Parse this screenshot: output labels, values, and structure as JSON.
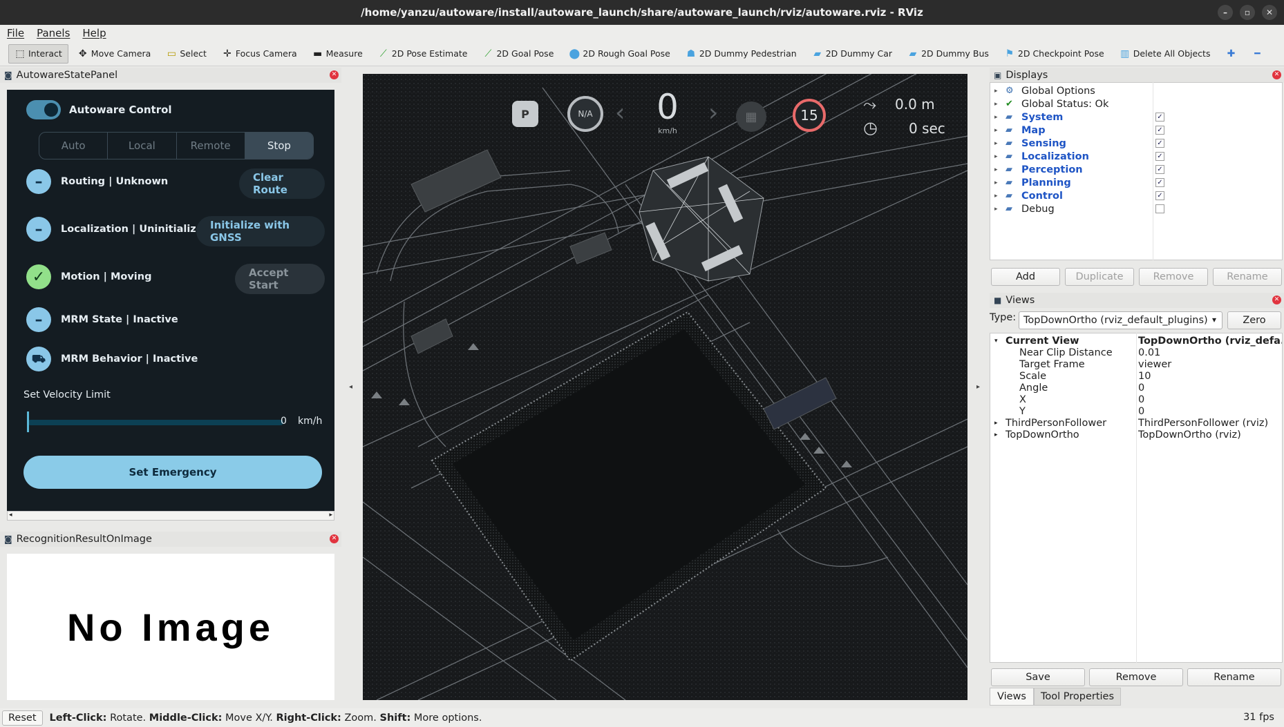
{
  "window": {
    "title": "/home/yanzu/autoware/install/autoware_launch/share/autoware_launch/rviz/autoware.rviz - RViz"
  },
  "menu": [
    "File",
    "Panels",
    "Help"
  ],
  "toolbar": [
    {
      "label": "Interact",
      "icon": "cursor-icon"
    },
    {
      "label": "Move Camera",
      "icon": "move-icon"
    },
    {
      "label": "Select",
      "icon": "select-icon"
    },
    {
      "label": "Focus Camera",
      "icon": "focus-icon"
    },
    {
      "label": "Measure",
      "icon": "ruler-icon"
    },
    {
      "label": "2D Pose Estimate",
      "icon": "arrow-green-icon"
    },
    {
      "label": "2D Goal Pose",
      "icon": "arrow-green-icon"
    },
    {
      "label": "2D Rough Goal Pose",
      "icon": "pin-icon"
    },
    {
      "label": "2D Dummy Pedestrian",
      "icon": "pedestrian-icon"
    },
    {
      "label": "2D Dummy Car",
      "icon": "car-icon"
    },
    {
      "label": "2D Dummy Bus",
      "icon": "bus-icon"
    },
    {
      "label": "2D Checkpoint Pose",
      "icon": "flag-icon"
    },
    {
      "label": "Delete All Objects",
      "icon": "trash-icon"
    }
  ],
  "autoware_panel": {
    "title": "AutowareStatePanel",
    "control_label": "Autoware Control",
    "modes": [
      "Auto",
      "Local",
      "Remote",
      "Stop"
    ],
    "routing": "Routing | Unknown",
    "routing_btn": "Clear Route",
    "localization": "Localization | Uninitialized",
    "localization_btn": "Initialize with GNSS",
    "motion": "Motion | Moving",
    "motion_btn": "Accept Start",
    "mrm_state": "MRM State | Inactive",
    "mrm_behavior": "MRM Behavior | Inactive",
    "velocity_label": "Set Velocity Limit",
    "velocity_value": "0",
    "velocity_unit": "km/h",
    "emergency_btn": "Set Emergency"
  },
  "recognition_panel": {
    "title": "RecognitionResultOnImage",
    "placeholder": "No Image"
  },
  "hud": {
    "gear": "P",
    "steering": "N/A",
    "speed": "0",
    "speed_unit": "km/h",
    "speed_limit": "15",
    "distance": "0.0 m",
    "time": "0 sec"
  },
  "displays": {
    "title": "Displays",
    "items": [
      {
        "label": "Global Options",
        "icon": "gear-icon",
        "blue": false,
        "check": null
      },
      {
        "label": "Global Status: Ok",
        "icon": "ok-check-icon",
        "blue": false,
        "check": null
      },
      {
        "label": "System",
        "icon": "folder-icon",
        "blue": true,
        "check": true
      },
      {
        "label": "Map",
        "icon": "folder-icon",
        "blue": true,
        "check": true
      },
      {
        "label": "Sensing",
        "icon": "folder-icon",
        "blue": true,
        "check": true
      },
      {
        "label": "Localization",
        "icon": "folder-icon",
        "blue": true,
        "check": true
      },
      {
        "label": "Perception",
        "icon": "folder-icon",
        "blue": true,
        "check": true
      },
      {
        "label": "Planning",
        "icon": "folder-icon",
        "blue": true,
        "check": true
      },
      {
        "label": "Control",
        "icon": "folder-icon",
        "blue": true,
        "check": true
      },
      {
        "label": "Debug",
        "icon": "folder-icon",
        "blue": false,
        "check": false
      }
    ],
    "buttons": [
      "Add",
      "Duplicate",
      "Remove",
      "Rename"
    ]
  },
  "views": {
    "title": "Views",
    "type_label": "Type:",
    "type_value": "TopDownOrtho (rviz_default_plugins)",
    "zero_btn": "Zero",
    "rows": [
      {
        "key": "Current View",
        "value": "TopDownOrtho (rviz_defa...",
        "level": 0,
        "bold": true,
        "arrow": "open"
      },
      {
        "key": "Near Clip Distance",
        "value": "0.01",
        "level": 1,
        "bold": false,
        "arrow": ""
      },
      {
        "key": "Target Frame",
        "value": "viewer",
        "level": 1,
        "bold": false,
        "arrow": ""
      },
      {
        "key": "Scale",
        "value": "10",
        "level": 1,
        "bold": false,
        "arrow": ""
      },
      {
        "key": "Angle",
        "value": "0",
        "level": 1,
        "bold": false,
        "arrow": ""
      },
      {
        "key": "X",
        "value": "0",
        "level": 1,
        "bold": false,
        "arrow": ""
      },
      {
        "key": "Y",
        "value": "0",
        "level": 1,
        "bold": false,
        "arrow": ""
      },
      {
        "key": "ThirdPersonFollower",
        "value": "ThirdPersonFollower (rviz)",
        "level": 0,
        "bold": false,
        "arrow": "closed"
      },
      {
        "key": "TopDownOrtho",
        "value": "TopDownOrtho (rviz)",
        "level": 0,
        "bold": false,
        "arrow": "closed"
      }
    ],
    "buttons": [
      "Save",
      "Remove",
      "Rename"
    ]
  },
  "bottom_tabs": [
    "Views",
    "Tool Properties"
  ],
  "status": {
    "reset": "Reset",
    "hint_parts": [
      {
        "b": "Left-Click:",
        "t": " Rotate. "
      },
      {
        "b": "Middle-Click:",
        "t": " Move X/Y. "
      },
      {
        "b": "Right-Click:",
        "t": " Zoom. "
      },
      {
        "b": "Shift:",
        "t": " More options."
      }
    ],
    "fps": "31 fps"
  }
}
